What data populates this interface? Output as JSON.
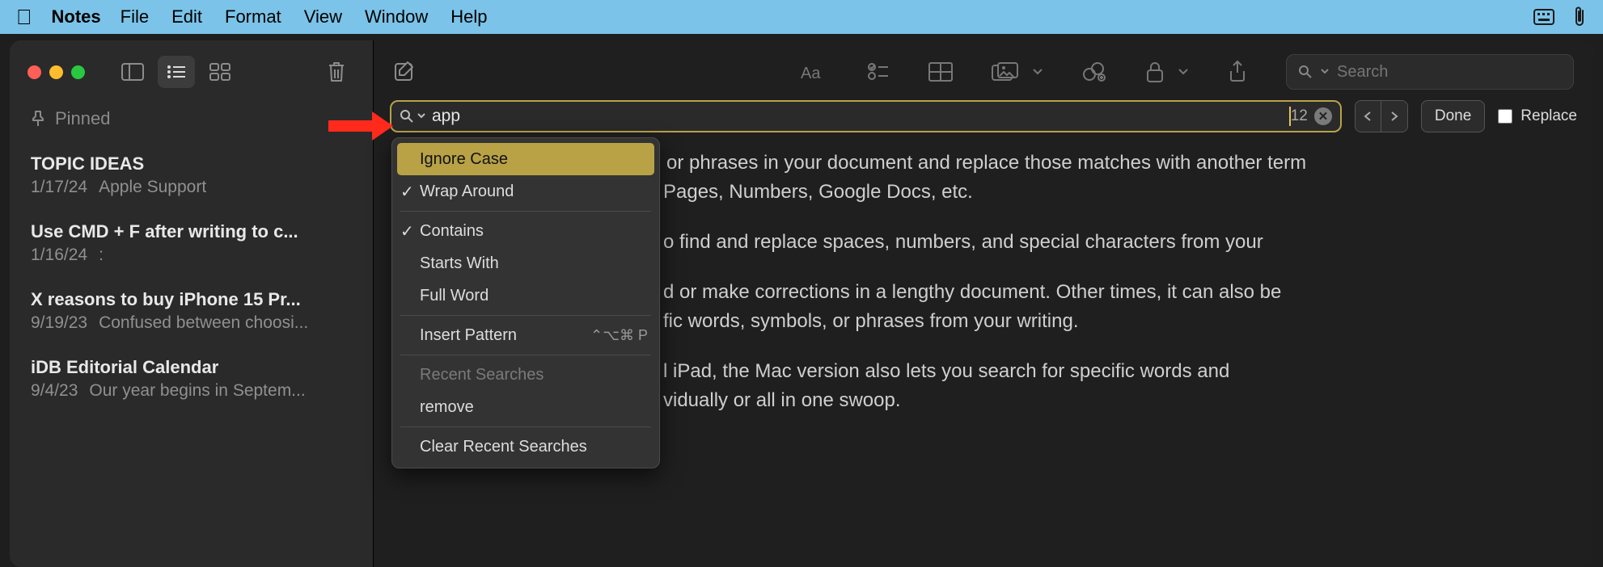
{
  "menubar": {
    "app": "Notes",
    "items": [
      "File",
      "Edit",
      "Format",
      "View",
      "Window",
      "Help"
    ]
  },
  "sidebar": {
    "pinned_label": "Pinned",
    "notes": [
      {
        "title": "TOPIC IDEAS",
        "date": "1/17/24",
        "preview": "Apple Support"
      },
      {
        "title": "Use CMD + F after writing to c...",
        "date": "1/16/24",
        "preview": ":"
      },
      {
        "title": "X reasons to buy iPhone 15 Pr...",
        "date": "9/19/23",
        "preview": "Confused between choosi..."
      },
      {
        "title": "iDB Editorial Calendar",
        "date": "9/4/23",
        "preview": "Our year begins in Septem..."
      }
    ]
  },
  "toolbar": {
    "search_placeholder": "Search"
  },
  "findbar": {
    "value": "app",
    "result_count": "12",
    "done_label": "Done",
    "replace_label": "Replace"
  },
  "dropdown": {
    "ignore_case": "Ignore Case",
    "wrap_around": "Wrap Around",
    "contains": "Contains",
    "starts_with": "Starts With",
    "full_word": "Full Word",
    "insert_pattern": "Insert Pattern",
    "insert_pattern_shortcut": "⌃⌥⌘ P",
    "recent_searches": "Recent Searches",
    "recent_item": "remove",
    "clear_recent": "Clear Recent Searches"
  },
  "document": {
    "p1": "or phrases in your document and replace those matches with another term",
    "p2": "Pages, Numbers, Google Docs, etc.",
    "p3": "o find and replace spaces, numbers, and special characters from your",
    "p4": "d or make corrections in a lengthy document. Other times, it can also be",
    "p5": "fic words, symbols, or phrases from your writing.",
    "p6": "l iPad, the Mac version also lets you search for specific words and",
    "p7": "vidually or all in one swoop."
  }
}
